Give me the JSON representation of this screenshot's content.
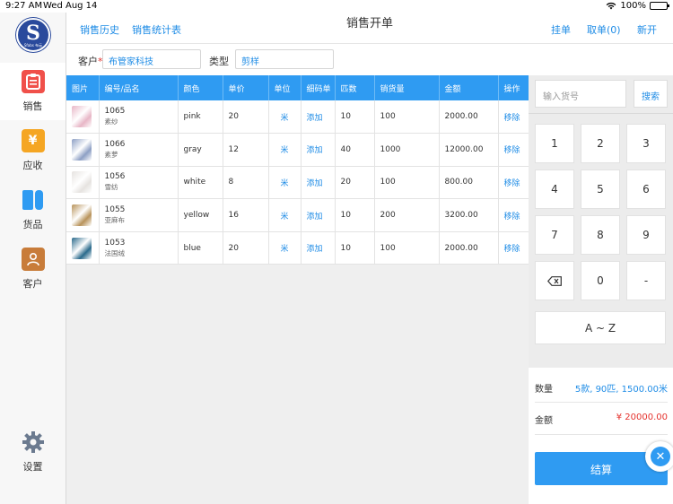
{
  "status": {
    "time": "9:27 AM",
    "date": "Wed Aug 14",
    "battery": "100%"
  },
  "logo": {
    "letter": "S",
    "sub": "Sfabs 布云"
  },
  "nav": [
    {
      "label": "销售",
      "icon": "clipboard-icon",
      "color": "#f0504a",
      "glyph": "≡",
      "active": true
    },
    {
      "label": "应收",
      "icon": "yen-icon",
      "color": "#f5a623",
      "glyph": "¥",
      "active": false
    },
    {
      "label": "货品",
      "icon": "fabric-roll-icon",
      "color": "#2f9bf2",
      "glyph": "▮",
      "active": false
    },
    {
      "label": "客户",
      "icon": "contact-card-icon",
      "color": "#c87c3a",
      "glyph": "☺",
      "active": false
    }
  ],
  "settings_label": "设置",
  "header": {
    "history": "销售历史",
    "stats": "销售统计表",
    "title": "销售开单",
    "hold": "挂单",
    "retrieve": "取单(0)",
    "new": "新开"
  },
  "customer": {
    "label": "客户",
    "required_mark": "*",
    "value": "布管家科技",
    "type_label": "类型",
    "type_value": "剪样"
  },
  "table": {
    "headers": [
      "图片",
      "编号/品名",
      "颜色",
      "单价",
      "单位",
      "细码单",
      "匹数",
      "销货量",
      "金额",
      "操作"
    ],
    "rows": [
      {
        "code": "1065",
        "name": "素纱",
        "color": "pink",
        "price": "20",
        "unit": "米",
        "detail": "添加",
        "pieces": "10",
        "qty": "100",
        "amount": "2000.00",
        "op": "移除",
        "swatch": "#e8b6c6"
      },
      {
        "code": "1066",
        "name": "素萝",
        "color": "gray",
        "price": "12",
        "unit": "米",
        "detail": "添加",
        "pieces": "40",
        "qty": "1000",
        "amount": "12000.00",
        "op": "移除",
        "swatch": "#8d9fc4"
      },
      {
        "code": "1056",
        "name": "雪纺",
        "color": "white",
        "price": "8",
        "unit": "米",
        "detail": "添加",
        "pieces": "20",
        "qty": "100",
        "amount": "800.00",
        "op": "移除",
        "swatch": "#e6e3e0"
      },
      {
        "code": "1055",
        "name": "亚麻布",
        "color": "yellow",
        "price": "16",
        "unit": "米",
        "detail": "添加",
        "pieces": "10",
        "qty": "200",
        "amount": "3200.00",
        "op": "移除",
        "swatch": "#b8935a"
      },
      {
        "code": "1053",
        "name": "法国绒",
        "color": "blue",
        "price": "20",
        "unit": "米",
        "detail": "添加",
        "pieces": "10",
        "qty": "100",
        "amount": "2000.00",
        "op": "移除",
        "swatch": "#2a6a8c"
      }
    ]
  },
  "search": {
    "placeholder": "输入货号",
    "button": "搜索"
  },
  "keypad": [
    "1",
    "2",
    "3",
    "4",
    "5",
    "6",
    "7",
    "8",
    "9",
    "⌫",
    "0",
    "-"
  ],
  "keypad_az": "A ~ Z",
  "summary": {
    "qty_label": "数量",
    "qty_value": "5款, 90匹, 1500.00米",
    "amount_label": "金额",
    "amount_value": "¥ 20000.00",
    "settle": "结算"
  },
  "colors": {
    "accent": "#2f9bf2",
    "link": "#1f8ce6",
    "amount": "#e5322d"
  }
}
